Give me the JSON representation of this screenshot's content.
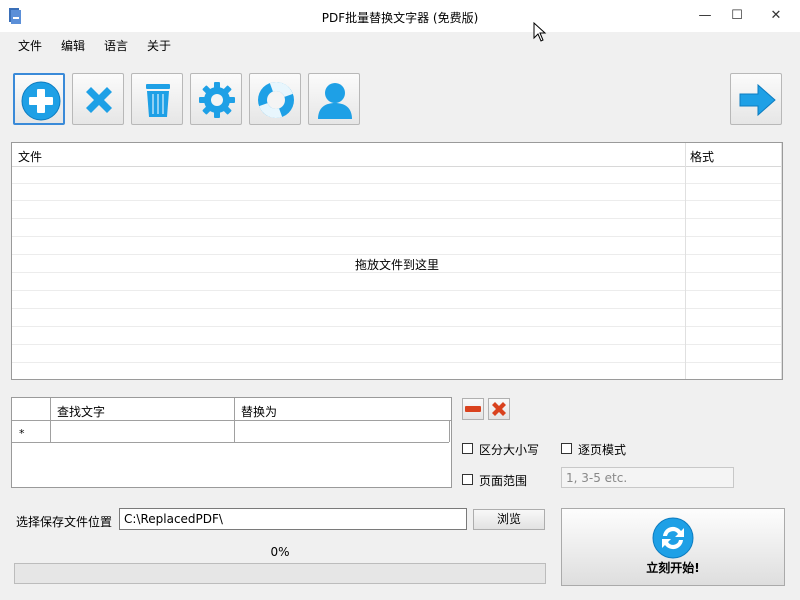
{
  "window": {
    "title": "PDF批量替换文字器 (免费版)",
    "controls": {
      "minimize": "—",
      "maximize": "☐",
      "close": "✕"
    }
  },
  "menu": [
    "文件",
    "编辑",
    "语言",
    "关于"
  ],
  "toolbar": {
    "buttons": [
      {
        "icon": "add-icon"
      },
      {
        "icon": "remove-icon"
      },
      {
        "icon": "trash-icon"
      },
      {
        "icon": "gear-icon"
      },
      {
        "icon": "help-lifebuoy-icon"
      },
      {
        "icon": "user-icon"
      }
    ],
    "next": {
      "icon": "arrow-right-icon"
    }
  },
  "file_table": {
    "columns": [
      "文件",
      "格式"
    ],
    "drop_hint": "拖放文件到这里"
  },
  "replace_grid": {
    "columns": [
      "查找文字",
      "替换为"
    ],
    "new_row_marker": "*"
  },
  "options": {
    "case_sensitive": {
      "label": "区分大小写",
      "checked": false
    },
    "page_mode": {
      "label": "逐页模式",
      "checked": false
    },
    "page_range": {
      "label": "页面范围",
      "checked": false
    },
    "page_range_placeholder": "1, 3-5 etc."
  },
  "save": {
    "label": "选择保存文件位置",
    "path": "C:\\ReplacedPDF\\",
    "browse": "浏览"
  },
  "progress": {
    "text": "0%",
    "value": 0
  },
  "start": {
    "label": "立刻开始!"
  },
  "colors": {
    "accent": "#1ea0e6",
    "danger": "#d9421e",
    "progress": "#06b025"
  }
}
